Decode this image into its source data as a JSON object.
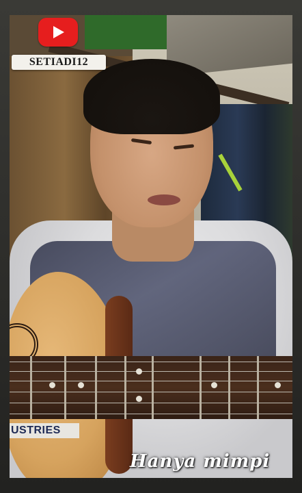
{
  "overlay": {
    "youtube_icon": "youtube-play-icon",
    "channel_name": "SETIADI12",
    "caption": "Hanya mimpi"
  },
  "video": {
    "guitar_sticker_text": "USTRIES"
  },
  "colors": {
    "youtube_red": "#e61e1e",
    "badge_background": "#f3f1ec",
    "caption_text": "#ffffff"
  }
}
